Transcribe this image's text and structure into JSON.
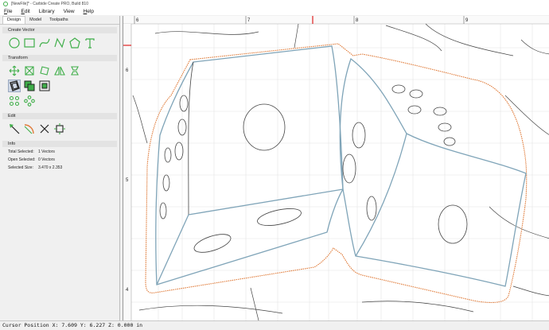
{
  "window": {
    "title": "[NewFile]* - Carbide Create PRO, Build 810"
  },
  "menu": {
    "items": [
      {
        "label": "File",
        "accel": "F",
        "rest": "ile"
      },
      {
        "label": "Edit",
        "accel": "E",
        "rest": "dit"
      },
      {
        "label": "Library",
        "accel": "",
        "rest": "Library"
      },
      {
        "label": "View",
        "accel": "",
        "rest": "View"
      },
      {
        "label": "Help",
        "accel": "H",
        "rest": "elp"
      }
    ]
  },
  "tabs": [
    "Design",
    "Model",
    "Toolpaths"
  ],
  "active_tab": "Design",
  "sections": {
    "create_vector": "Create Vector",
    "transform": "Transform",
    "edit": "Edit",
    "info": "Info"
  },
  "icons": {
    "create_vector": [
      "circle-icon",
      "rectangle-icon",
      "curve-icon",
      "polyline-icon",
      "polygon-icon",
      "text-icon"
    ],
    "transform_row1": [
      "move-icon",
      "scale-icon",
      "rotate-icon",
      "mirror-icon",
      "align-icon"
    ],
    "transform_row2": [
      "offset-icon",
      "boolean-union-icon",
      "boolean-subtract-icon"
    ],
    "transform_row3": [
      "circular-array-icon",
      "linear-array-icon"
    ],
    "edit": [
      "node-edit-icon",
      "fillet-icon",
      "trim-icon",
      "join-icon"
    ]
  },
  "info": [
    {
      "label": "Total Selected:",
      "value": "1 Vectors"
    },
    {
      "label": "Open Selected:",
      "value": "0 Vectors"
    },
    {
      "label": "Selected Size:",
      "value": "3.470 x 2.353"
    }
  ],
  "ruler": {
    "top": [
      "6",
      "7",
      "8",
      "9"
    ],
    "left": [
      "6",
      "5",
      "4"
    ]
  },
  "status": {
    "cursor": "Cursor Position X: 7.609 Y: 6.227 Z: 0.000 in"
  },
  "colors": {
    "accent": "#3fae49",
    "selection": "#7fa4b8",
    "offset": "#e07b39",
    "vector": "#333333"
  }
}
